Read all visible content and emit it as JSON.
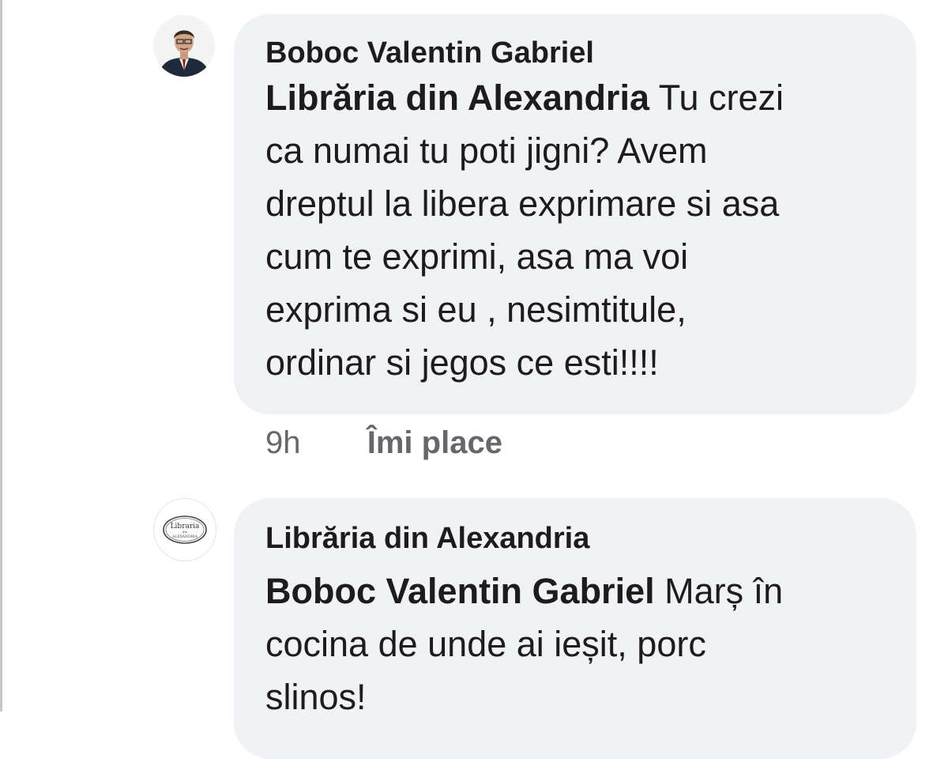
{
  "comments": [
    {
      "author": "Boboc Valentin Gabriel",
      "mention": "Librăria din Alexandria",
      "text_lines": [
        "Tu crezi",
        "ca numai tu poti jigni? Avem",
        "dreptul la libera exprimare si asa",
        "cum te exprimi, asa ma voi",
        "exprima si eu , nesimtitule,",
        "ordinar si jegos ce esti!!!!"
      ],
      "time": "9h",
      "like_label": "Îmi place"
    },
    {
      "author": "Librăria din Alexandria",
      "mention": "Boboc Valentin Gabriel",
      "text_lines": [
        "Marș în",
        "cocina de unde ai ieșit, porc",
        "slinos!"
      ],
      "avatar_logo_text": "Libraria din Alexandria"
    }
  ]
}
